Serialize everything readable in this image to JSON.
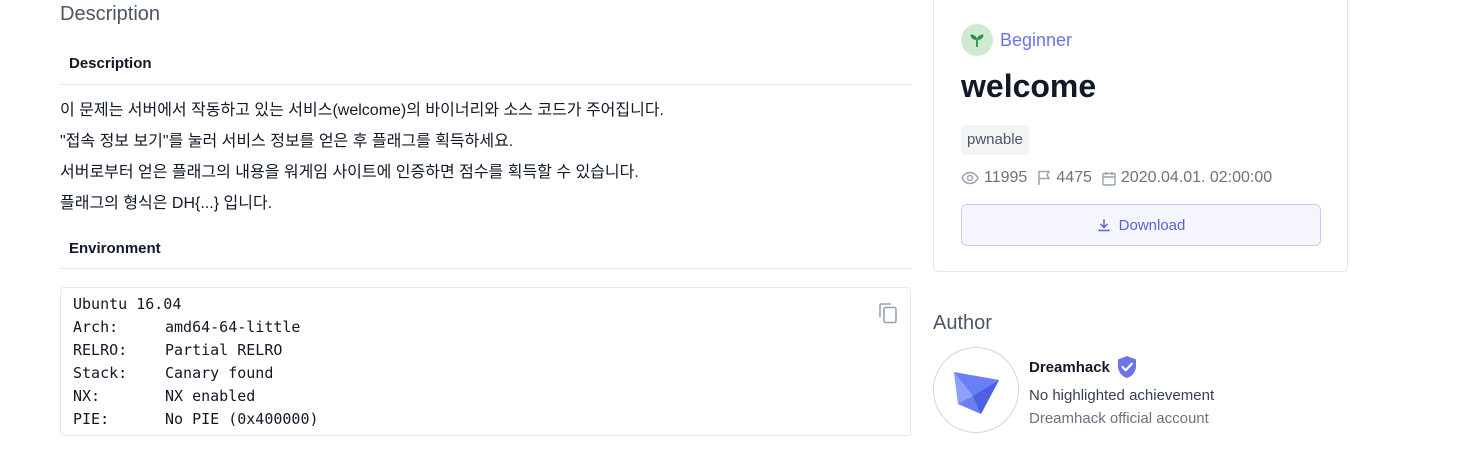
{
  "description": {
    "section_title": "Description",
    "sub_title": "Description",
    "lines": [
      "이 문제는 서버에서 작동하고 있는 서비스(welcome)의 바이너리와 소스 코드가 주어집니다.",
      "\"접속 정보 보기\"를 눌러 서비스 정보를 얻은 후 플래그를 획득하세요.",
      "서버로부터 얻은 플래그의 내용을 워게임 사이트에 인증하면 점수를 획득할 수 있습니다.",
      "플래그의 형식은 DH{...} 입니다."
    ]
  },
  "environment": {
    "sub_title": "Environment",
    "first_line": "Ubuntu 16.04",
    "rows": [
      {
        "key": "Arch:",
        "value": "amd64-64-little"
      },
      {
        "key": "RELRO:",
        "value": "Partial RELRO"
      },
      {
        "key": "Stack:",
        "value": "Canary found"
      },
      {
        "key": "NX:",
        "value": "NX enabled"
      },
      {
        "key": "PIE:",
        "value": "No PIE (0x400000)"
      }
    ],
    "copy_icon": "copy-icon"
  },
  "challenge": {
    "level": "Beginner",
    "level_icon": "sprout-icon",
    "title": "welcome",
    "tag": "pwnable",
    "views": "11995",
    "solves": "4475",
    "date": "2020.04.01. 02:00:00",
    "download_label": "Download"
  },
  "author": {
    "section_title": "Author",
    "name": "Dreamhack",
    "achievement": "No highlighted achievement",
    "description": "Dreamhack official account"
  },
  "colors": {
    "accent": "#6b73e8",
    "level_badge_bg": "#cfe9d3",
    "border": "#e5e7eb"
  }
}
